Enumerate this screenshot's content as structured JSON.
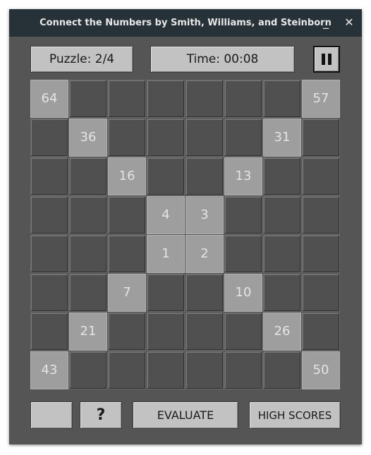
{
  "window": {
    "title": "Connect the Numbers by Smith, Williams, and Steinborn",
    "minimize_glyph": "_",
    "close_glyph": "✕"
  },
  "toolbar": {
    "puzzle_label": "Puzzle: 2/4",
    "time_label": "Time: 00:08",
    "pause_icon": "pause-icon"
  },
  "grid": {
    "rows": 8,
    "cols": 8,
    "cells": [
      [
        "64",
        "",
        "",
        "",
        "",
        "",
        "",
        "57"
      ],
      [
        "",
        "36",
        "",
        "",
        "",
        "",
        "31",
        ""
      ],
      [
        "",
        "",
        "16",
        "",
        "",
        "13",
        "",
        ""
      ],
      [
        "",
        "",
        "",
        "4",
        "3",
        "",
        "",
        ""
      ],
      [
        "",
        "",
        "",
        "1",
        "2",
        "",
        "",
        ""
      ],
      [
        "",
        "",
        "7",
        "",
        "",
        "10",
        "",
        ""
      ],
      [
        "",
        "21",
        "",
        "",
        "",
        "",
        "26",
        ""
      ],
      [
        "43",
        "",
        "",
        "",
        "",
        "",
        "",
        "50"
      ]
    ]
  },
  "bottom": {
    "blank_label": "",
    "hint_label": "?",
    "evaluate_label": "EVALUATE",
    "high_scores_label": "HIGH SCORES"
  },
  "colors": {
    "window_bg": "#555555",
    "titlebar_bg": "#263238",
    "button_bg": "#c2c2c2",
    "given_cell_bg": "#9e9e9e",
    "empty_cell_bg": "#505050"
  }
}
